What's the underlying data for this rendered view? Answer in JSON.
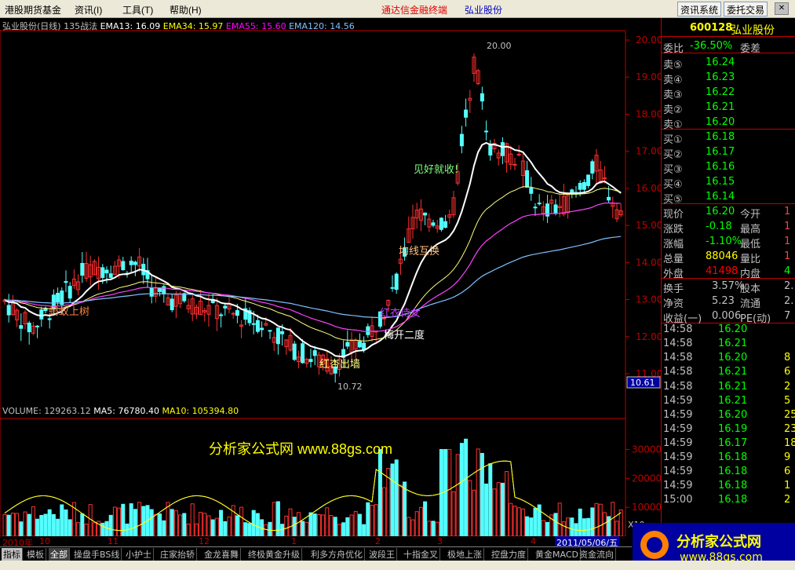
{
  "menu": {
    "items": [
      "港股期货基金",
      "资讯(I)",
      "工具(T)",
      "帮助(H)"
    ],
    "app_title": "通达信金融终端",
    "stock_title": "弘业股份",
    "btn_info": "资讯系统",
    "btn_trade": "委托交易",
    "close": "✕"
  },
  "chart_header": {
    "stock": "弘业股份(日线)",
    "formula": "135战法",
    "ema13": "EMA13: 16.09",
    "ema34": "EMA34: 15.97",
    "ema55": "EMA55: 15.60",
    "ema120": "EMA120: 14.56"
  },
  "volume_header": {
    "volume": "VOLUME: 129263.12",
    "ma5": "MA5: 76780.40",
    "ma10": "MA10: 105394.80"
  },
  "price_axis": [
    "20.00",
    "19.00",
    "18.00",
    "17.00",
    "16.00",
    "15.00",
    "14.00",
    "13.00",
    "12.00",
    "11.00"
  ],
  "vol_axis": [
    "30000",
    "20000",
    "10000"
  ],
  "vol_unit": "X10",
  "cursor_price": "10.61",
  "annotations": {
    "high": "20.00",
    "low": "10.72",
    "a1": "蚂蚁上树",
    "a2": "红杏出墙",
    "a3": "梅开二度",
    "a4": "均线互换",
    "a5": "见好就收!",
    "a6": "红衣侍女"
  },
  "watermark": "分析家公式网  www.88gs.com",
  "dates": {
    "year": "2010年",
    "m10": "10",
    "m11": "11",
    "m12": "12",
    "m1": "1",
    "m2": "2",
    "m3": "3",
    "m4": "4",
    "current": "2011/05/06/五"
  },
  "tabs": [
    "指标",
    "模板",
    "全部",
    "操盘手BS线",
    "小护士",
    "庄家抬轿",
    "金龙喜舞",
    "终极黄金升级",
    "利多方舟优化",
    "波段王",
    "十指金叉",
    "极地上涨",
    "控盘力度",
    "黄金MACD",
    "资金流向"
  ],
  "quote": {
    "code": "600128",
    "name": "弘业股份",
    "webi_label": "委比",
    "webi_value": "-36.50%",
    "wecha_label": "委差",
    "sells": [
      {
        "label": "卖⑤",
        "price": "16.24"
      },
      {
        "label": "卖④",
        "price": "16.23"
      },
      {
        "label": "卖③",
        "price": "16.22"
      },
      {
        "label": "卖②",
        "price": "16.21"
      },
      {
        "label": "卖①",
        "price": "16.20"
      }
    ],
    "buys": [
      {
        "label": "买①",
        "price": "16.18"
      },
      {
        "label": "买②",
        "price": "16.17"
      },
      {
        "label": "买③",
        "price": "16.16"
      },
      {
        "label": "买④",
        "price": "16.15"
      },
      {
        "label": "买⑤",
        "price": "16.14"
      }
    ],
    "stats": [
      {
        "l1": "现价",
        "v1": "16.20",
        "l2": "今开",
        "v2": "1"
      },
      {
        "l1": "涨跌",
        "v1": "-0.18",
        "l2": "最高",
        "v2": "1"
      },
      {
        "l1": "涨幅",
        "v1": "-1.10%",
        "l2": "最低",
        "v2": "1"
      },
      {
        "l1": "总量",
        "v1": "88046",
        "l2": "量比",
        "v2": "1"
      },
      {
        "l1": "外盘",
        "v1": "41498",
        "l2": "内盘",
        "v2": "4"
      }
    ],
    "stats2": [
      {
        "l1": "换手",
        "v1": "3.57%",
        "l2": "股本",
        "v2": "2."
      },
      {
        "l1": "净资",
        "v1": "5.23",
        "l2": "流通",
        "v2": "2."
      },
      {
        "l1": "收益(一)",
        "v1": "0.006",
        "l2": "PE(动)",
        "v2": "7"
      }
    ],
    "ticks": [
      {
        "t": "14:58",
        "p": "16.20",
        "v": ""
      },
      {
        "t": "14:58",
        "p": "16.21",
        "v": ""
      },
      {
        "t": "14:58",
        "p": "16.20",
        "v": "8"
      },
      {
        "t": "14:58",
        "p": "16.21",
        "v": "6"
      },
      {
        "t": "14:58",
        "p": "16.21",
        "v": "2"
      },
      {
        "t": "14:59",
        "p": "16.21",
        "v": "5"
      },
      {
        "t": "14:59",
        "p": "16.20",
        "v": "25"
      },
      {
        "t": "14:59",
        "p": "16.19",
        "v": "23"
      },
      {
        "t": "14:59",
        "p": "16.17",
        "v": "18"
      },
      {
        "t": "14:59",
        "p": "16.18",
        "v": "9"
      },
      {
        "t": "14:59",
        "p": "16.18",
        "v": "6"
      },
      {
        "t": "14:59",
        "p": "16.18",
        "v": "1"
      },
      {
        "t": "15:00",
        "p": "16.18",
        "v": "2"
      }
    ]
  },
  "logo_text": "分析家公式网",
  "logo_url": "www.88gs.com"
}
